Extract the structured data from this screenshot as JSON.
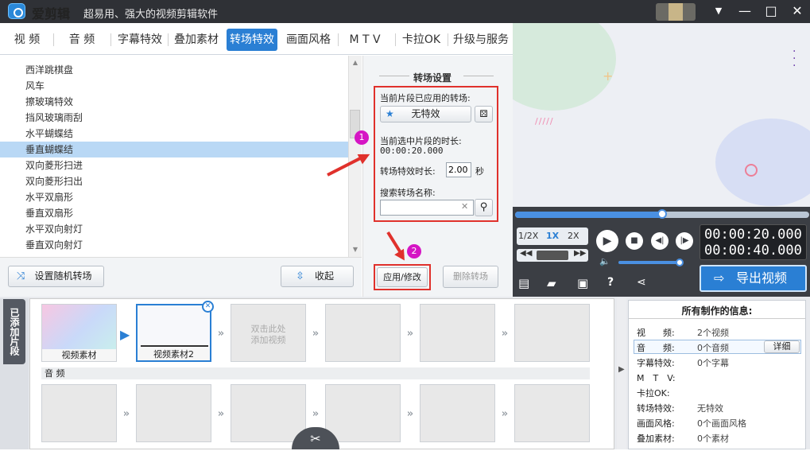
{
  "window": {
    "app_name": "爱剪辑",
    "slogan": "超易用、强大的视频剪辑软件",
    "minimize": "—",
    "maximize": "□",
    "close": "✕",
    "menu": "▼"
  },
  "tabs": [
    "视 频",
    "音 频",
    "字幕特效",
    "叠加素材",
    "转场特效",
    "画面风格",
    "M T V",
    "卡拉OK",
    "升级与服务"
  ],
  "active_tab": "转场特效",
  "effects": [
    "西洋跳棋盘",
    "风车",
    "擦玻璃特效",
    "挡风玻璃雨刮",
    "水平蝴蝶结",
    "垂直蝴蝶结",
    "双向菱形扫进",
    "双向菱形扫出",
    "水平双扇形",
    "垂直双扇形",
    "水平双向射灯",
    "垂直双向射灯"
  ],
  "selected_effect": "垂直蝴蝶结",
  "list_footer": {
    "random_button": "设置随机转场",
    "collapse_button": "收起"
  },
  "settings": {
    "title": "转场设置",
    "applied_label": "当前片段已应用的转场:",
    "applied_value": "无特效",
    "duration_label": "当前选中片段的时长:",
    "duration_value": "00:00:20.000",
    "effect_duration_label": "转场特效时长:",
    "effect_duration_value": "2.00",
    "effect_duration_unit": "秒",
    "search_label": "搜索转场名称:",
    "search_value": "",
    "apply_button": "应用/修改",
    "delete_button": "删除转场"
  },
  "annotations": {
    "badge1": "1",
    "badge2": "2"
  },
  "player": {
    "speeds": [
      "1/2X",
      "1X",
      "2X"
    ],
    "active_speed": "1X",
    "current_time": "00:00:20.000",
    "total_time": "00:00:40.000",
    "export_button": "导出视频",
    "progress": 0.5
  },
  "track": {
    "side_label": "已添加片段",
    "clips": [
      {
        "label": "视频素材"
      },
      {
        "label": "视频素材2"
      }
    ],
    "add_hint_line1": "双击此处",
    "add_hint_line2": "添加视频",
    "audio_label": "音 频"
  },
  "info": {
    "title": "所有制作的信息:",
    "rows": [
      {
        "key": "视　　频:",
        "value": "2个视频"
      },
      {
        "key": "音　　频:",
        "value": "0个音频"
      },
      {
        "key": "字幕特效:",
        "value": "0个字幕"
      },
      {
        "key": "M　T　V:",
        "value": ""
      },
      {
        "key": "卡拉OK:",
        "value": ""
      },
      {
        "key": "转场特效:",
        "value": "无特效"
      },
      {
        "key": "画面风格:",
        "value": "0个画面风格"
      },
      {
        "key": "叠加素材:",
        "value": "0个素材"
      }
    ],
    "detail_button": "详细"
  },
  "colors": {
    "accent": "#2a7fd4",
    "highlight": "#e0312c",
    "badge": "#d515c4",
    "titlebar": "#2f3136"
  }
}
